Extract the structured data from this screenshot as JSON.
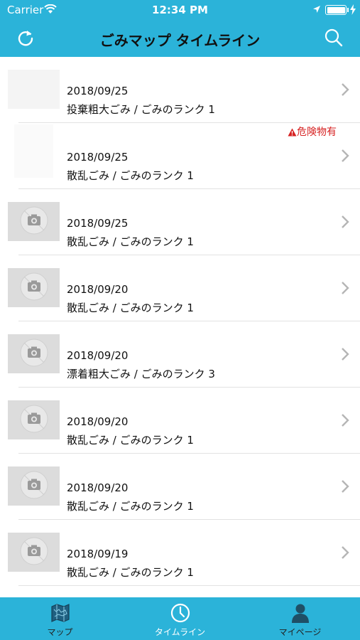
{
  "status_bar": {
    "carrier": "Carrier",
    "time": "12:34 PM"
  },
  "nav": {
    "title": "ごみマップ タイムライン",
    "left_icon": "refresh-icon",
    "right_icon": "search-icon"
  },
  "items": [
    {
      "date": "2018/09/25",
      "desc": "投棄粗大ごみ / ごみのランク 1",
      "thumb": "photo",
      "danger": ""
    },
    {
      "date": "2018/09/25",
      "desc": "散乱ごみ / ごみのランク 1",
      "thumb": "photo2",
      "danger": "危険物有"
    },
    {
      "date": "2018/09/25",
      "desc": "散乱ごみ / ごみのランク 1",
      "thumb": "placeholder",
      "danger": ""
    },
    {
      "date": "2018/09/20",
      "desc": "散乱ごみ / ごみのランク 1",
      "thumb": "placeholder",
      "danger": ""
    },
    {
      "date": "2018/09/20",
      "desc": "漂着粗大ごみ / ごみのランク 3",
      "thumb": "placeholder",
      "danger": ""
    },
    {
      "date": "2018/09/20",
      "desc": "散乱ごみ / ごみのランク 1",
      "thumb": "placeholder",
      "danger": ""
    },
    {
      "date": "2018/09/20",
      "desc": "散乱ごみ / ごみのランク 1",
      "thumb": "placeholder",
      "danger": ""
    },
    {
      "date": "2018/09/19",
      "desc": "散乱ごみ / ごみのランク 1",
      "thumb": "placeholder",
      "danger": ""
    }
  ],
  "tabs": [
    {
      "label": "マップ",
      "icon": "map-icon",
      "active": false
    },
    {
      "label": "タイムライン",
      "icon": "clock-icon",
      "active": true
    },
    {
      "label": "マイページ",
      "icon": "person-icon",
      "active": false
    }
  ],
  "colors": {
    "accent": "#2bb3d9",
    "danger": "#d62020"
  }
}
